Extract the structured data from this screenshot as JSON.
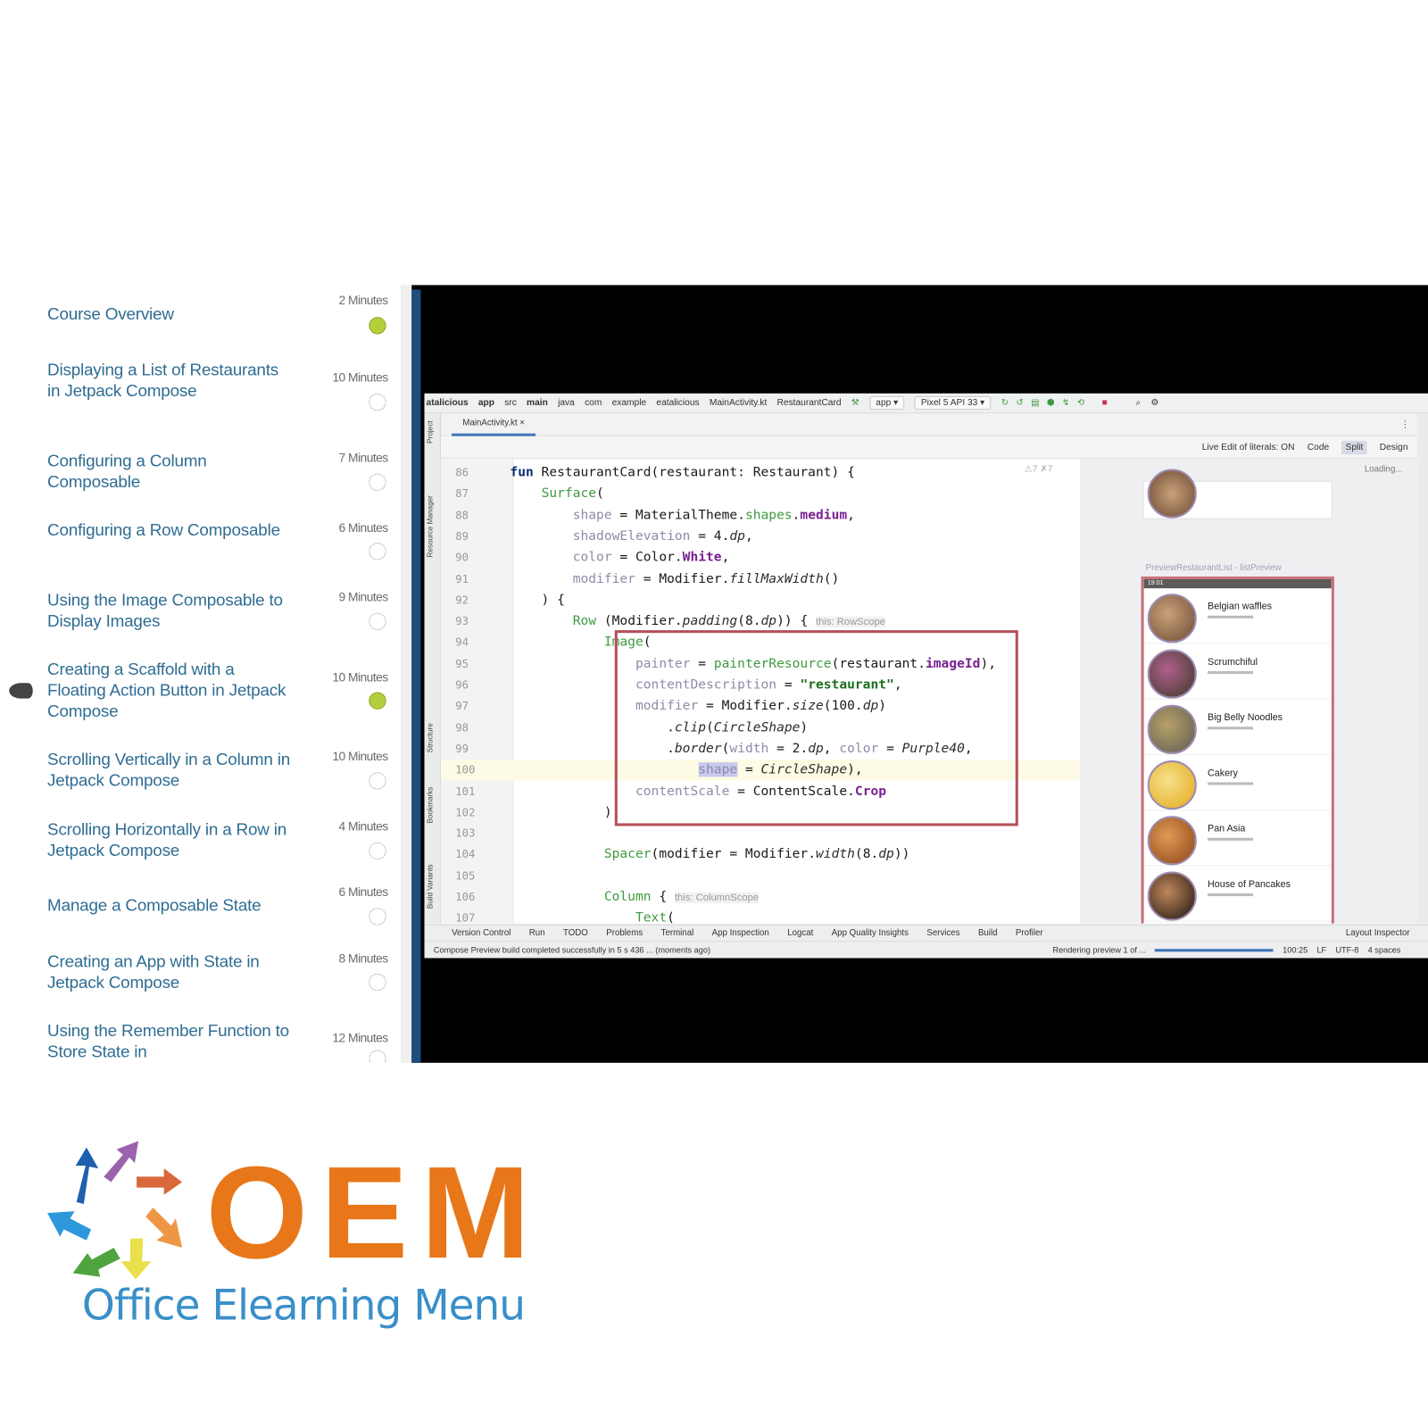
{
  "course_list": {
    "lessons": [
      {
        "title": "Course Overview",
        "duration": "2 Minutes",
        "status": "completed"
      },
      {
        "title": "Displaying a List of Restaurants in Jetpack Compose",
        "duration": "10 Minutes",
        "status": "not-started"
      },
      {
        "title": "Configuring a Column Composable",
        "duration": "7 Minutes",
        "status": "not-started"
      },
      {
        "title": "Configuring a Row Composable",
        "duration": "6 Minutes",
        "status": "not-started"
      },
      {
        "title": "Using the Image Composable to Display Images",
        "duration": "9 Minutes",
        "status": "not-started"
      },
      {
        "title": "Creating a Scaffold with a Floating Action Button in Jetpack Compose",
        "duration": "10 Minutes",
        "status": "completed",
        "current": true
      },
      {
        "title": "Scrolling Vertically in a Column in Jetpack Compose",
        "duration": "10 Minutes",
        "status": "not-started"
      },
      {
        "title": "Scrolling Horizontally in a Row in Jetpack Compose",
        "duration": "4 Minutes",
        "status": "not-started"
      },
      {
        "title": "Manage a Composable State",
        "duration": "6 Minutes",
        "status": "not-started"
      },
      {
        "title": "Creating an App with State in Jetpack Compose",
        "duration": "8 Minutes",
        "status": "not-started"
      },
      {
        "title": "Using the Remember Function to Store State in",
        "duration": "12 Minutes",
        "status": "not-started"
      }
    ],
    "status_colors": {
      "completed": "#b4cf3c"
    }
  },
  "ide": {
    "breadcrumbs": [
      "atalicious",
      "app",
      "src",
      "main",
      "java",
      "com",
      "example",
      "eatalicious",
      "MainActivity.kt",
      "RestaurantCard"
    ],
    "run_config": "app",
    "device": "Pixel 5 API 33",
    "file_tab": "MainActivity.kt",
    "live_edit": "Live Edit of literals: ON",
    "view_modes": {
      "code": "Code",
      "split": "Split",
      "design": "Design",
      "active": "Split"
    },
    "inspections": "⚠7 ✗7",
    "loading": "Loading...",
    "left_tools": [
      "Project",
      "Resource Manager",
      "Structure",
      "Bookmarks",
      "Build Variants"
    ],
    "code_lines": [
      {
        "n": "86",
        "tokens": [
          [
            "fun",
            "kw"
          ],
          [
            " RestaurantCard(restaurant: Restaurant) {",
            ""
          ]
        ]
      },
      {
        "n": "87",
        "tokens": [
          [
            "    ",
            ""
          ],
          [
            "Surface",
            "fn"
          ],
          [
            "(",
            ""
          ]
        ]
      },
      {
        "n": "88",
        "tokens": [
          [
            "        ",
            ""
          ],
          [
            "shape",
            "param"
          ],
          [
            " = MaterialTheme.",
            ""
          ],
          [
            "shapes",
            "grn"
          ],
          [
            ".",
            ""
          ],
          [
            "medium",
            "prop"
          ],
          [
            ",",
            ""
          ]
        ]
      },
      {
        "n": "89",
        "tokens": [
          [
            "        ",
            ""
          ],
          [
            "shadowElevation",
            "param"
          ],
          [
            " = 4.",
            ""
          ],
          [
            "dp",
            "it"
          ],
          [
            ",",
            ""
          ]
        ]
      },
      {
        "n": "90",
        "tokens": [
          [
            "        ",
            ""
          ],
          [
            "color",
            "param"
          ],
          [
            " = Color.",
            ""
          ],
          [
            "White",
            "prop"
          ],
          [
            ",",
            ""
          ]
        ]
      },
      {
        "n": "91",
        "tokens": [
          [
            "        ",
            ""
          ],
          [
            "modifier",
            "param"
          ],
          [
            " = Modifier.",
            ""
          ],
          [
            "fillMaxWidth",
            "it"
          ],
          [
            "()",
            ""
          ]
        ]
      },
      {
        "n": "92",
        "tokens": [
          [
            "    ) {",
            ""
          ]
        ]
      },
      {
        "n": "93",
        "tokens": [
          [
            "        ",
            ""
          ],
          [
            "Row",
            "fn"
          ],
          [
            " (Modifier.",
            ""
          ],
          [
            "padding",
            "it"
          ],
          [
            "(8.",
            ""
          ],
          [
            "dp",
            "it"
          ],
          [
            ")) { ",
            ""
          ],
          [
            "this: RowScope",
            "hint"
          ]
        ]
      },
      {
        "n": "94",
        "tokens": [
          [
            "            ",
            ""
          ],
          [
            "Image",
            "fn"
          ],
          [
            "(",
            ""
          ]
        ]
      },
      {
        "n": "95",
        "tokens": [
          [
            "                ",
            ""
          ],
          [
            "painter",
            "param"
          ],
          [
            " = ",
            ""
          ],
          [
            "painterResource",
            "fn"
          ],
          [
            "(restaurant.",
            ""
          ],
          [
            "imageId",
            "prop"
          ],
          [
            "),",
            ""
          ]
        ]
      },
      {
        "n": "96",
        "tokens": [
          [
            "                ",
            ""
          ],
          [
            "contentDescription",
            "param"
          ],
          [
            " = ",
            ""
          ],
          [
            "\"restaurant\"",
            "str"
          ],
          [
            ",",
            ""
          ]
        ]
      },
      {
        "n": "97",
        "tokens": [
          [
            "                ",
            ""
          ],
          [
            "modifier",
            "param"
          ],
          [
            " = Modifier.",
            ""
          ],
          [
            "size",
            "it"
          ],
          [
            "(100.",
            ""
          ],
          [
            "dp",
            "it"
          ],
          [
            ")",
            ""
          ]
        ]
      },
      {
        "n": "98",
        "tokens": [
          [
            "                    .",
            ""
          ],
          [
            "clip",
            "it"
          ],
          [
            "(",
            ""
          ],
          [
            "CircleShape",
            "it"
          ],
          [
            ")",
            ""
          ]
        ]
      },
      {
        "n": "99",
        "tokens": [
          [
            "                    .",
            ""
          ],
          [
            "border",
            "it"
          ],
          [
            "(",
            ""
          ],
          [
            "width",
            "param"
          ],
          [
            " = 2.",
            ""
          ],
          [
            "dp",
            "it"
          ],
          [
            ", ",
            ""
          ],
          [
            "color",
            "param"
          ],
          [
            " = ",
            ""
          ],
          [
            "Purple40",
            "it"
          ],
          [
            ",",
            ""
          ]
        ]
      },
      {
        "n": "100",
        "current": true,
        "tokens": [
          [
            "                        ",
            ""
          ],
          [
            "shape",
            "param sel"
          ],
          [
            " = ",
            ""
          ],
          [
            "CircleShape",
            "it"
          ],
          [
            "),",
            ""
          ]
        ]
      },
      {
        "n": "101",
        "tokens": [
          [
            "                ",
            ""
          ],
          [
            "contentScale",
            "param"
          ],
          [
            " = ContentScale.",
            ""
          ],
          [
            "Crop",
            "prop"
          ]
        ]
      },
      {
        "n": "102",
        "tokens": [
          [
            "            )",
            ""
          ]
        ]
      },
      {
        "n": "103",
        "tokens": []
      },
      {
        "n": "104",
        "tokens": [
          [
            "            ",
            ""
          ],
          [
            "Spacer",
            "fn"
          ],
          [
            "(modifier = Modifier.",
            ""
          ],
          [
            "width",
            "it"
          ],
          [
            "(8.",
            ""
          ],
          [
            "dp",
            "it"
          ],
          [
            "))",
            ""
          ]
        ]
      },
      {
        "n": "105",
        "tokens": []
      },
      {
        "n": "106",
        "tokens": [
          [
            "            ",
            ""
          ],
          [
            "Column",
            "fn"
          ],
          [
            " { ",
            ""
          ],
          [
            "this: ColumnScope",
            "hint"
          ]
        ]
      },
      {
        "n": "107",
        "tokens": [
          [
            "                ",
            ""
          ],
          [
            "Text",
            "fn"
          ],
          [
            "(",
            ""
          ]
        ]
      }
    ],
    "preview": {
      "label": "PreviewRestaurantList - listPreview",
      "status_time": "19:01",
      "restaurants": [
        {
          "name": "Belgian waffles",
          "colors": [
            "#c9a27a",
            "#6d4a33"
          ]
        },
        {
          "name": "Scrumchiful",
          "colors": [
            "#b05f8c",
            "#3d3a2a"
          ]
        },
        {
          "name": "Big Belly Noodles",
          "colors": [
            "#b8a26a",
            "#5e5a52"
          ]
        },
        {
          "name": "Cakery",
          "colors": [
            "#f7e08a",
            "#e3a91c"
          ]
        },
        {
          "name": "Pan Asia",
          "colors": [
            "#e09a55",
            "#8b4517"
          ]
        },
        {
          "name": "House of Pancakes",
          "colors": [
            "#c0875a",
            "#1c1410"
          ]
        }
      ]
    },
    "tool_windows": [
      "Version Control",
      "Run",
      "TODO",
      "Problems",
      "Terminal",
      "App Inspection",
      "Logcat",
      "App Quality Insights",
      "Services",
      "Build",
      "Profiler"
    ],
    "layout_inspector": "Layout Inspector",
    "status": {
      "message": "Compose Preview build completed successfully in 5 s 436 ... (moments ago)",
      "rendering": "Rendering preview 1 of ...",
      "position": "100:25",
      "line_sep": "LF",
      "encoding": "UTF-8",
      "indent": "4 spaces"
    }
  },
  "logo": {
    "wordmark": "OEM",
    "tagline": "Office Elearning Menu",
    "colors": {
      "wordmark": "#e8771a",
      "tagline": "#3a8fc8"
    }
  }
}
